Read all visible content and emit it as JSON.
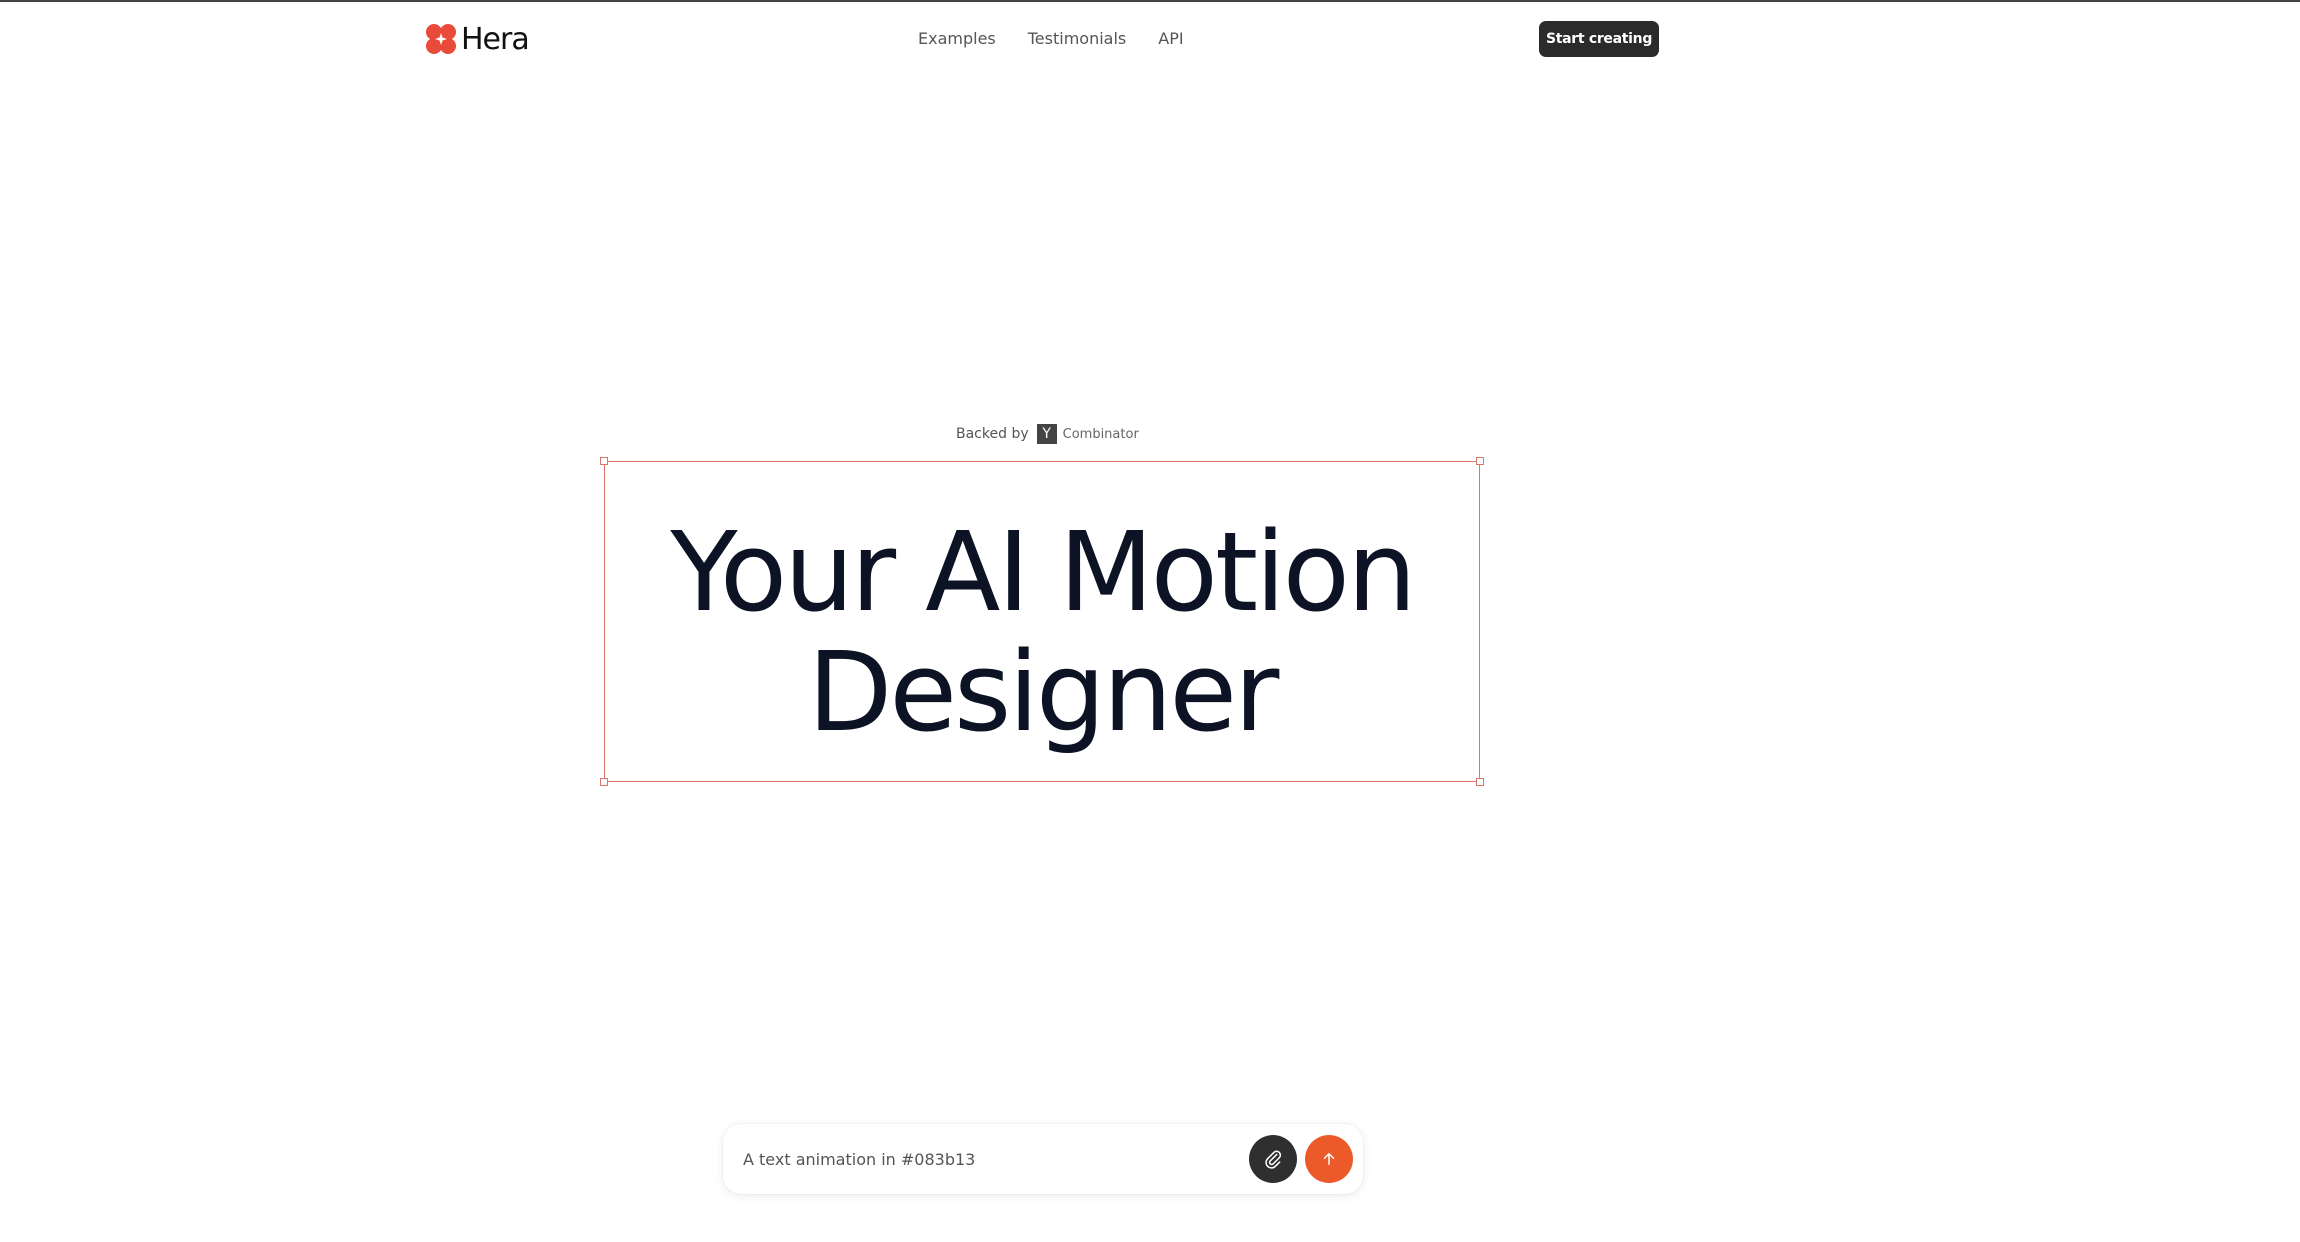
{
  "header": {
    "logo_text": "Hera",
    "nav": [
      {
        "label": "Examples"
      },
      {
        "label": "Testimonials"
      },
      {
        "label": "API"
      }
    ],
    "cta_label": "Start creating"
  },
  "hero": {
    "backed_by_label": "Backed by",
    "yc_letter": "Y",
    "yc_name": "Combinator",
    "headline_line1": "Your AI Motion",
    "headline_line2": "Designer"
  },
  "prompt": {
    "placeholder": "A text animation in #083b13"
  },
  "icons": {
    "logo": "hera-flower-logo-icon",
    "attach": "paperclip-icon",
    "send": "arrow-up-icon"
  },
  "colors": {
    "accent": "#ec5a2a",
    "selection": "#d9766a",
    "headline": "#0b1324",
    "cta_bg": "#2b2b2b"
  }
}
